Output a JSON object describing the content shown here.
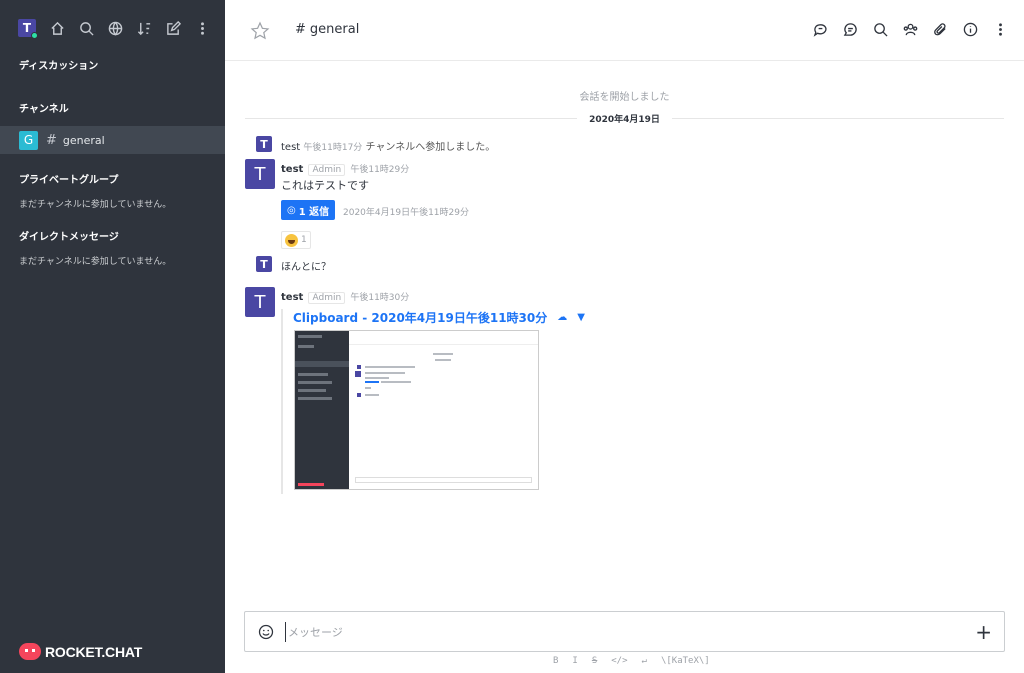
{
  "sidebar": {
    "user_initial": "T",
    "sections": {
      "discussion": "ディスカッション",
      "channels": "チャンネル",
      "private": "プライベートグループ",
      "private_empty": "まだチャンネルに参加していません。",
      "direct": "ダイレクトメッセージ",
      "direct_empty": "まだチャンネルに参加していません。"
    },
    "rooms": [
      {
        "initial": "G",
        "name": "general"
      }
    ],
    "logo_text": "ROCKET.CHAT"
  },
  "header": {
    "room_name": "general",
    "actions": [
      "discussion-icon",
      "thread-icon",
      "search-icon",
      "members-icon",
      "attachment-icon",
      "info-icon",
      "kebab-icon"
    ]
  },
  "messages": {
    "start_text": "会話を開始しました",
    "date_divider": "2020年4月19日",
    "system": {
      "initial": "T",
      "user": "test",
      "time": "午後11時17分",
      "text": "チャンネルへ参加しました。"
    },
    "msg1": {
      "initial": "T",
      "user": "test",
      "role": "Admin",
      "time": "午後11時29分",
      "text": "これはテストです",
      "reply_label": "1 返信",
      "reply_time": "2020年4月19日午後11時29分",
      "reaction_count": "1"
    },
    "msg2": {
      "initial": "T",
      "text": "ほんとに？"
    },
    "msg3": {
      "initial": "T",
      "user": "test",
      "role": "Admin",
      "time": "午後11時30分",
      "attachment_title": "Clipboard - 2020年4月19日午後11時30分"
    }
  },
  "composer": {
    "placeholder": "メッセージ",
    "format_hints": [
      "B",
      "I",
      "S",
      "</>",
      "↵",
      "\\[KaTeX\\]"
    ]
  },
  "colors": {
    "sidebar_bg": "#2f343d",
    "accent": "#1d74f5",
    "avatar": "#4a47a3",
    "room_avatar": "#2bbbd3",
    "online": "#2de0a5",
    "brand": "#f5455c"
  }
}
